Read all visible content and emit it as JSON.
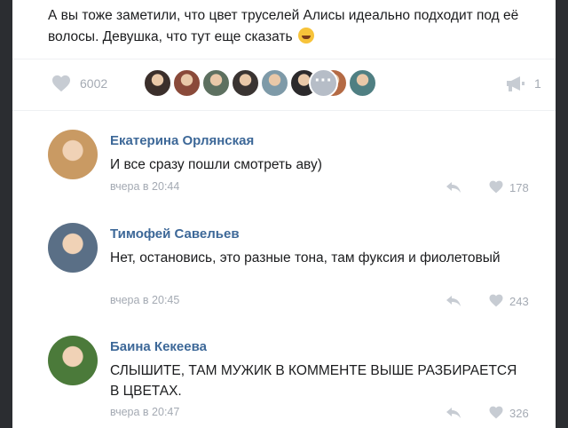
{
  "post": {
    "text": "А вы тоже заметили, что цвет труселей Алисы идеально подходит под её волосы. Девушка, что тут еще сказать",
    "emoji_icon": "grinning-face-icon",
    "likes_count": "6002",
    "shares_count": "1",
    "liker_avatar_colors": [
      "#3b2f2b",
      "#8a4a3a",
      "#5d7060",
      "#3a3432",
      "#7e9aa8",
      "#2c2a2c",
      "#b46a44",
      "#4f7f82"
    ]
  },
  "comments": [
    {
      "author": "Екатерина Орлянская",
      "text": "И все сразу пошли смотреть аву)",
      "time": "вчера в 20:44",
      "likes": "178",
      "avatar_color": "#c99a63"
    },
    {
      "author": "Тимофей Савельев",
      "text": "Нет, остановись, это разные тона, там фуксия и фиолетовый",
      "time": "вчера в 20:45",
      "likes": "243",
      "avatar_color": "#5a6f86"
    },
    {
      "author": "Баина Кекеева",
      "text": "СЛЫШИТЕ, ТАМ МУЖИК В КОММЕНТЕ ВЫШЕ РАЗБИРАЕТСЯ В ЦВЕТАХ.",
      "time": "вчера в 20:47",
      "likes": "326",
      "avatar_color": "#4b7a3a"
    }
  ],
  "colors": {
    "link_blue": "#3d6898",
    "meta_gray": "#a4aab3"
  }
}
